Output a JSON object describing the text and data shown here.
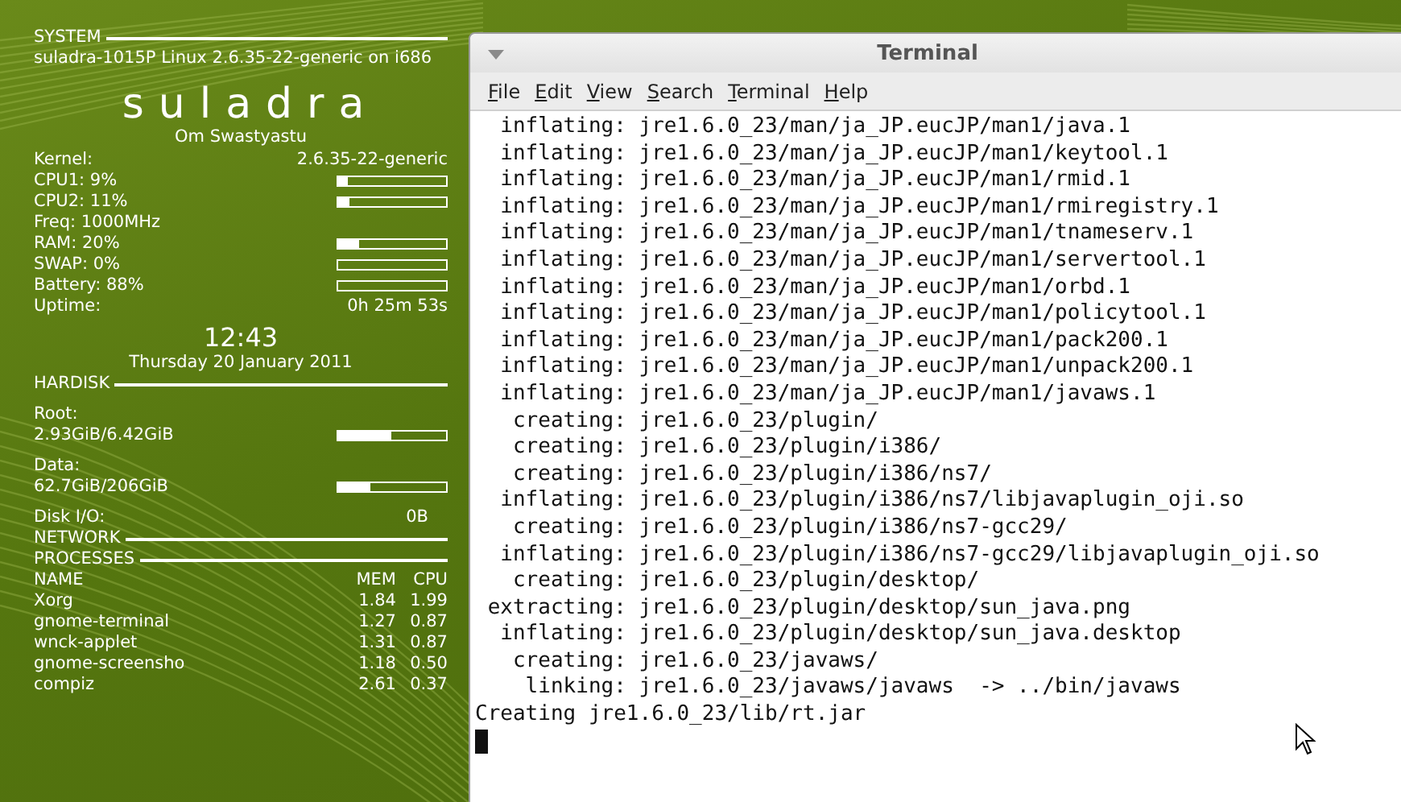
{
  "conky": {
    "system": {
      "heading": "SYSTEM",
      "host": "suladra-1015P Linux 2.6.35-22-generic on i686",
      "name": "suladra",
      "motto": "Om Swastyastu",
      "rows": [
        {
          "kind": "value",
          "label": "Kernel:",
          "value": "2.6.35-22-generic"
        },
        {
          "kind": "bar",
          "label": "CPU1: 9%",
          "level": 0.09
        },
        {
          "kind": "bar",
          "label": "CPU2: 11%",
          "level": 0.11
        },
        {
          "kind": "label",
          "label": "Freq: 1000MHz"
        },
        {
          "kind": "bar",
          "label": "RAM: 20%",
          "level": 0.2
        },
        {
          "kind": "bar",
          "label": "SWAP: 0%",
          "level": 0
        },
        {
          "kind": "bar",
          "label": "Battery: 88%",
          "level": 0
        },
        {
          "kind": "value",
          "label": "Uptime:",
          "value": "0h 25m 53s"
        }
      ],
      "time": "12:43",
      "date": "Thursday 20 January 2011"
    },
    "hardisk": {
      "heading": "HARDISK",
      "disks": [
        {
          "label": "Root:",
          "usage": "2.93GiB/6.42GiB",
          "level": 0.49
        },
        {
          "label": "Data:",
          "usage": "62.7GiB/206GiB",
          "level": 0.3
        }
      ],
      "io_label": "Disk I/O:",
      "io_value": "0B"
    },
    "network": {
      "heading": "NETWORK"
    },
    "processes": {
      "heading": "PROCESSES",
      "columns": [
        "NAME",
        "MEM",
        "CPU"
      ],
      "rows": [
        [
          "Xorg",
          "1.84",
          "1.99"
        ],
        [
          "gnome-terminal",
          "1.27",
          "0.87"
        ],
        [
          "wnck-applet",
          "1.31",
          "0.87"
        ],
        [
          "gnome-screensho",
          "1.18",
          "0.50"
        ],
        [
          "compiz",
          "2.61",
          "0.37"
        ]
      ]
    }
  },
  "terminal": {
    "title": "Terminal",
    "menu": [
      "File",
      "Edit",
      "View",
      "Search",
      "Terminal",
      "Help"
    ],
    "lines": [
      "  inflating: jre1.6.0_23/man/ja_JP.eucJP/man1/java.1",
      "  inflating: jre1.6.0_23/man/ja_JP.eucJP/man1/keytool.1",
      "  inflating: jre1.6.0_23/man/ja_JP.eucJP/man1/rmid.1",
      "  inflating: jre1.6.0_23/man/ja_JP.eucJP/man1/rmiregistry.1",
      "  inflating: jre1.6.0_23/man/ja_JP.eucJP/man1/tnameserv.1",
      "  inflating: jre1.6.0_23/man/ja_JP.eucJP/man1/servertool.1",
      "  inflating: jre1.6.0_23/man/ja_JP.eucJP/man1/orbd.1",
      "  inflating: jre1.6.0_23/man/ja_JP.eucJP/man1/policytool.1",
      "  inflating: jre1.6.0_23/man/ja_JP.eucJP/man1/pack200.1",
      "  inflating: jre1.6.0_23/man/ja_JP.eucJP/man1/unpack200.1",
      "  inflating: jre1.6.0_23/man/ja_JP.eucJP/man1/javaws.1",
      "   creating: jre1.6.0_23/plugin/",
      "   creating: jre1.6.0_23/plugin/i386/",
      "   creating: jre1.6.0_23/plugin/i386/ns7/",
      "  inflating: jre1.6.0_23/plugin/i386/ns7/libjavaplugin_oji.so",
      "   creating: jre1.6.0_23/plugin/i386/ns7-gcc29/",
      "  inflating: jre1.6.0_23/plugin/i386/ns7-gcc29/libjavaplugin_oji.so",
      "   creating: jre1.6.0_23/plugin/desktop/",
      " extracting: jre1.6.0_23/plugin/desktop/sun_java.png",
      "  inflating: jre1.6.0_23/plugin/desktop/sun_java.desktop",
      "   creating: jre1.6.0_23/javaws/",
      "    linking: jre1.6.0_23/javaws/javaws  -> ../bin/javaws",
      "Creating jre1.6.0_23/lib/rt.jar"
    ]
  }
}
